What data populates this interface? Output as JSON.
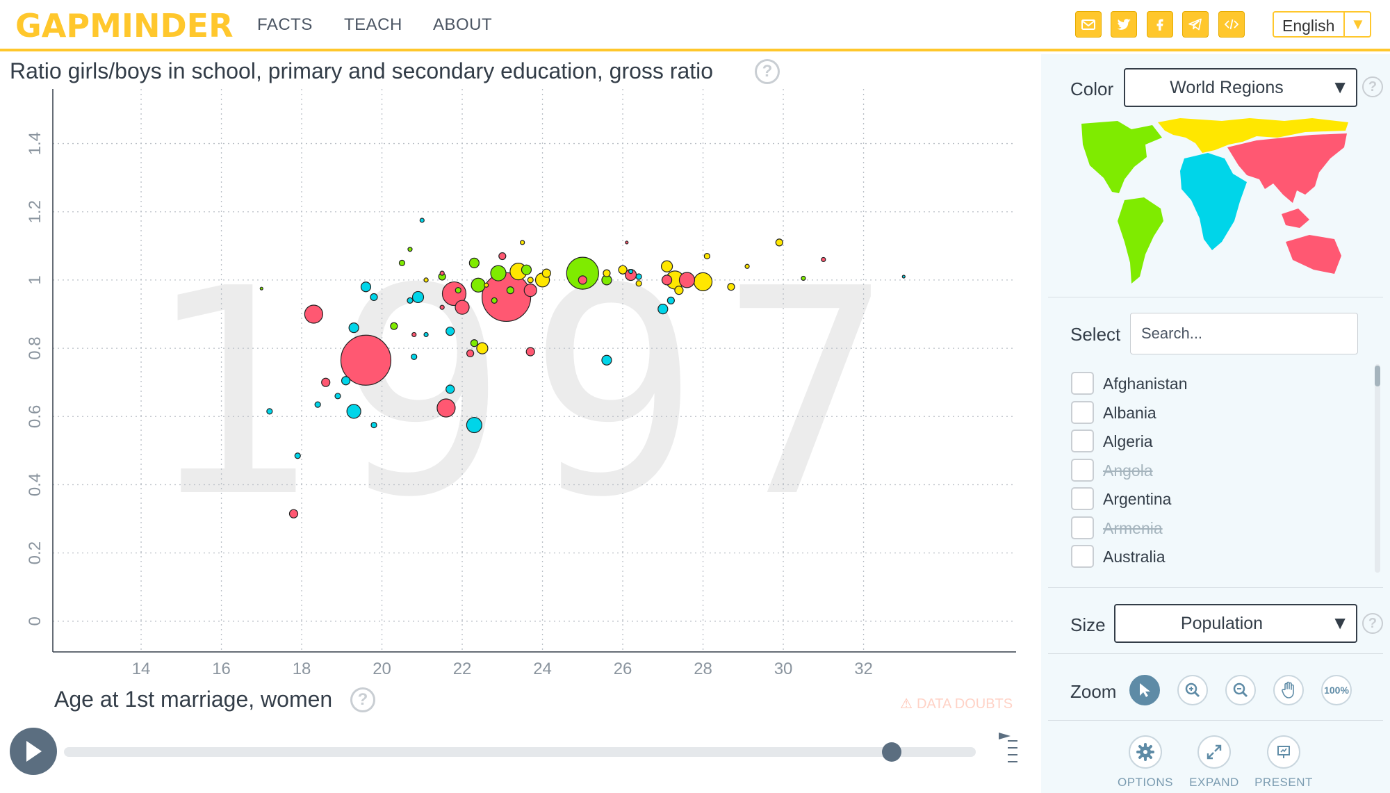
{
  "header": {
    "logo_text": "GAPMINDER",
    "nav": [
      "FACTS",
      "TEACH",
      "ABOUT"
    ],
    "share_icons": [
      "mail-icon",
      "twitter-icon",
      "facebook-icon",
      "telegram-icon",
      "embed-code-icon"
    ],
    "language": "English",
    "accent_color": "#ffc72c"
  },
  "chart": {
    "y_title": "Ratio girls/boys in school, primary and secondary education, gross ratio",
    "x_title": "Age at 1st marriage, women",
    "year": "1997",
    "data_doubts": "DATA DOUBTS"
  },
  "chart_data": {
    "type": "scatter",
    "title": "",
    "xlabel": "Age at 1st marriage, women",
    "ylabel": "Ratio girls/boys in school, primary and secondary education, gross ratio",
    "xlim": [
      11.8,
      35.8
    ],
    "ylim": [
      -0.09,
      1.56
    ],
    "x_ticks": [
      14,
      16,
      18,
      20,
      22,
      24,
      26,
      28,
      30,
      32
    ],
    "y_ticks": [
      0,
      0.2,
      0.4,
      0.6,
      0.8,
      1,
      1.2,
      1.4
    ],
    "y_tick_labels": [
      "0",
      "0.2",
      "0.4",
      "0.6",
      "0.8",
      "1",
      "1.2",
      "1.4"
    ],
    "grid": true,
    "size_by": "Population",
    "color_by": "World Regions",
    "region_colors": {
      "africa": "#00d5e9",
      "americas": "#7feb00",
      "asia": "#ff5872",
      "europe": "#ffe700"
    },
    "points": [
      {
        "x": 23.1,
        "y": 0.95,
        "r": 35,
        "region": "asia"
      },
      {
        "x": 19.6,
        "y": 0.765,
        "r": 36,
        "region": "asia"
      },
      {
        "x": 21.8,
        "y": 0.96,
        "r": 17,
        "region": "asia"
      },
      {
        "x": 21.6,
        "y": 0.625,
        "r": 13,
        "region": "asia"
      },
      {
        "x": 18.3,
        "y": 0.9,
        "r": 13,
        "region": "asia"
      },
      {
        "x": 22.0,
        "y": 0.92,
        "r": 10,
        "region": "asia"
      },
      {
        "x": 27.6,
        "y": 1.0,
        "r": 11,
        "region": "asia"
      },
      {
        "x": 26.2,
        "y": 1.015,
        "r": 8,
        "region": "asia"
      },
      {
        "x": 23.7,
        "y": 0.97,
        "r": 9,
        "region": "asia"
      },
      {
        "x": 23.0,
        "y": 1.07,
        "r": 5,
        "region": "asia"
      },
      {
        "x": 18.6,
        "y": 0.7,
        "r": 6,
        "region": "asia"
      },
      {
        "x": 17.8,
        "y": 0.315,
        "r": 6,
        "region": "asia"
      },
      {
        "x": 23.7,
        "y": 0.79,
        "r": 6,
        "region": "asia"
      },
      {
        "x": 22.2,
        "y": 0.785,
        "r": 5,
        "region": "asia"
      },
      {
        "x": 25.0,
        "y": 1.0,
        "r": 6,
        "region": "asia"
      },
      {
        "x": 27.1,
        "y": 1.0,
        "r": 7,
        "region": "asia"
      },
      {
        "x": 20.8,
        "y": 0.84,
        "r": 3,
        "region": "asia"
      },
      {
        "x": 21.5,
        "y": 0.92,
        "r": 3,
        "region": "asia"
      },
      {
        "x": 21.5,
        "y": 1.02,
        "r": 3,
        "region": "asia"
      },
      {
        "x": 25.0,
        "y": 1.02,
        "r": 23,
        "region": "americas"
      },
      {
        "x": 22.9,
        "y": 1.02,
        "r": 11,
        "region": "americas"
      },
      {
        "x": 22.4,
        "y": 0.985,
        "r": 10,
        "region": "americas"
      },
      {
        "x": 22.3,
        "y": 1.05,
        "r": 7,
        "region": "americas"
      },
      {
        "x": 23.6,
        "y": 1.03,
        "r": 7,
        "region": "americas"
      },
      {
        "x": 25.6,
        "y": 1.0,
        "r": 7,
        "region": "americas"
      },
      {
        "x": 22.3,
        "y": 0.815,
        "r": 5,
        "region": "americas"
      },
      {
        "x": 20.5,
        "y": 1.05,
        "r": 4,
        "region": "americas"
      },
      {
        "x": 20.3,
        "y": 0.865,
        "r": 5,
        "region": "americas"
      },
      {
        "x": 21.5,
        "y": 1.01,
        "r": 5,
        "region": "americas"
      },
      {
        "x": 23.2,
        "y": 0.97,
        "r": 5,
        "region": "americas"
      },
      {
        "x": 21.9,
        "y": 0.97,
        "r": 4,
        "region": "americas"
      },
      {
        "x": 30.5,
        "y": 1.005,
        "r": 3,
        "region": "americas"
      },
      {
        "x": 22.8,
        "y": 0.94,
        "r": 4,
        "region": "americas"
      },
      {
        "x": 17.0,
        "y": 0.975,
        "r": 2,
        "region": "americas"
      },
      {
        "x": 27.3,
        "y": 1.0,
        "r": 13,
        "region": "europe"
      },
      {
        "x": 28.0,
        "y": 0.995,
        "r": 13,
        "region": "europe"
      },
      {
        "x": 23.4,
        "y": 1.025,
        "r": 12,
        "region": "europe"
      },
      {
        "x": 24.0,
        "y": 1.0,
        "r": 10,
        "region": "europe"
      },
      {
        "x": 27.1,
        "y": 1.04,
        "r": 8,
        "region": "europe"
      },
      {
        "x": 22.5,
        "y": 0.8,
        "r": 8,
        "region": "europe"
      },
      {
        "x": 26.0,
        "y": 1.03,
        "r": 6,
        "region": "europe"
      },
      {
        "x": 27.4,
        "y": 0.97,
        "r": 6,
        "region": "europe"
      },
      {
        "x": 28.7,
        "y": 0.98,
        "r": 5,
        "region": "europe"
      },
      {
        "x": 29.9,
        "y": 1.11,
        "r": 5,
        "region": "europe"
      },
      {
        "x": 25.6,
        "y": 1.02,
        "r": 5,
        "region": "europe"
      },
      {
        "x": 24.1,
        "y": 1.02,
        "r": 6,
        "region": "europe"
      },
      {
        "x": 28.1,
        "y": 1.07,
        "r": 4,
        "region": "europe"
      },
      {
        "x": 26.4,
        "y": 0.99,
        "r": 4,
        "region": "europe"
      },
      {
        "x": 21.1,
        "y": 1.0,
        "r": 3,
        "region": "europe"
      },
      {
        "x": 29.1,
        "y": 1.04,
        "r": 3,
        "region": "europe"
      },
      {
        "x": 23.7,
        "y": 1.0,
        "r": 4,
        "region": "europe"
      },
      {
        "x": 22.6,
        "y": 0.985,
        "r": 3,
        "region": "europe"
      },
      {
        "x": 22.3,
        "y": 0.575,
        "r": 11,
        "region": "africa"
      },
      {
        "x": 25.6,
        "y": 0.765,
        "r": 7,
        "region": "africa"
      },
      {
        "x": 19.3,
        "y": 0.615,
        "r": 10,
        "region": "africa"
      },
      {
        "x": 19.6,
        "y": 0.98,
        "r": 7,
        "region": "africa"
      },
      {
        "x": 20.9,
        "y": 0.95,
        "r": 8,
        "region": "africa"
      },
      {
        "x": 27.0,
        "y": 0.915,
        "r": 7,
        "region": "africa"
      },
      {
        "x": 19.3,
        "y": 0.86,
        "r": 7,
        "region": "africa"
      },
      {
        "x": 21.7,
        "y": 0.68,
        "r": 6,
        "region": "africa"
      },
      {
        "x": 19.1,
        "y": 0.705,
        "r": 6,
        "region": "africa"
      },
      {
        "x": 21.7,
        "y": 0.85,
        "r": 6,
        "region": "africa"
      },
      {
        "x": 17.2,
        "y": 0.615,
        "r": 4,
        "region": "africa"
      },
      {
        "x": 17.9,
        "y": 0.485,
        "r": 4,
        "region": "africa"
      },
      {
        "x": 19.8,
        "y": 0.95,
        "r": 5,
        "region": "africa"
      },
      {
        "x": 20.7,
        "y": 0.94,
        "r": 4,
        "region": "africa"
      },
      {
        "x": 18.4,
        "y": 0.635,
        "r": 4,
        "region": "africa"
      },
      {
        "x": 19.8,
        "y": 0.575,
        "r": 4,
        "region": "africa"
      },
      {
        "x": 18.9,
        "y": 0.66,
        "r": 4,
        "region": "africa"
      },
      {
        "x": 20.8,
        "y": 0.775,
        "r": 4,
        "region": "africa"
      },
      {
        "x": 21.1,
        "y": 0.84,
        "r": 3,
        "region": "africa"
      },
      {
        "x": 27.2,
        "y": 0.94,
        "r": 5,
        "region": "africa"
      },
      {
        "x": 21.0,
        "y": 1.175,
        "r": 3,
        "region": "africa"
      },
      {
        "x": 26.4,
        "y": 1.01,
        "r": 4,
        "region": "africa"
      },
      {
        "x": 26.2,
        "y": 1.025,
        "r": 3,
        "region": "africa"
      },
      {
        "x": 33.0,
        "y": 1.01,
        "r": 2,
        "region": "africa"
      },
      {
        "x": 20.7,
        "y": 1.09,
        "r": 3,
        "region": "americas"
      },
      {
        "x": 23.5,
        "y": 1.11,
        "r": 3,
        "region": "europe"
      },
      {
        "x": 31.0,
        "y": 1.06,
        "r": 3,
        "region": "asia"
      },
      {
        "x": 26.1,
        "y": 1.11,
        "r": 2,
        "region": "asia"
      }
    ]
  },
  "timeline": {
    "play_label": "Play",
    "start_year": 1800,
    "end_year": 2017,
    "current_year": 1997
  },
  "panel": {
    "color_label": "Color",
    "color_value": "World Regions",
    "select_label": "Select",
    "search_placeholder": "Search...",
    "countries": [
      {
        "name": "Afghanistan",
        "available": true
      },
      {
        "name": "Albania",
        "available": true
      },
      {
        "name": "Algeria",
        "available": true
      },
      {
        "name": "Angola",
        "available": false
      },
      {
        "name": "Argentina",
        "available": true
      },
      {
        "name": "Armenia",
        "available": false
      },
      {
        "name": "Australia",
        "available": true
      }
    ],
    "size_label": "Size",
    "size_value": "Population",
    "zoom_label": "Zoom",
    "zoom_100": "100%",
    "options_label": "OPTIONS",
    "expand_label": "EXPAND",
    "present_label": "PRESENT"
  }
}
